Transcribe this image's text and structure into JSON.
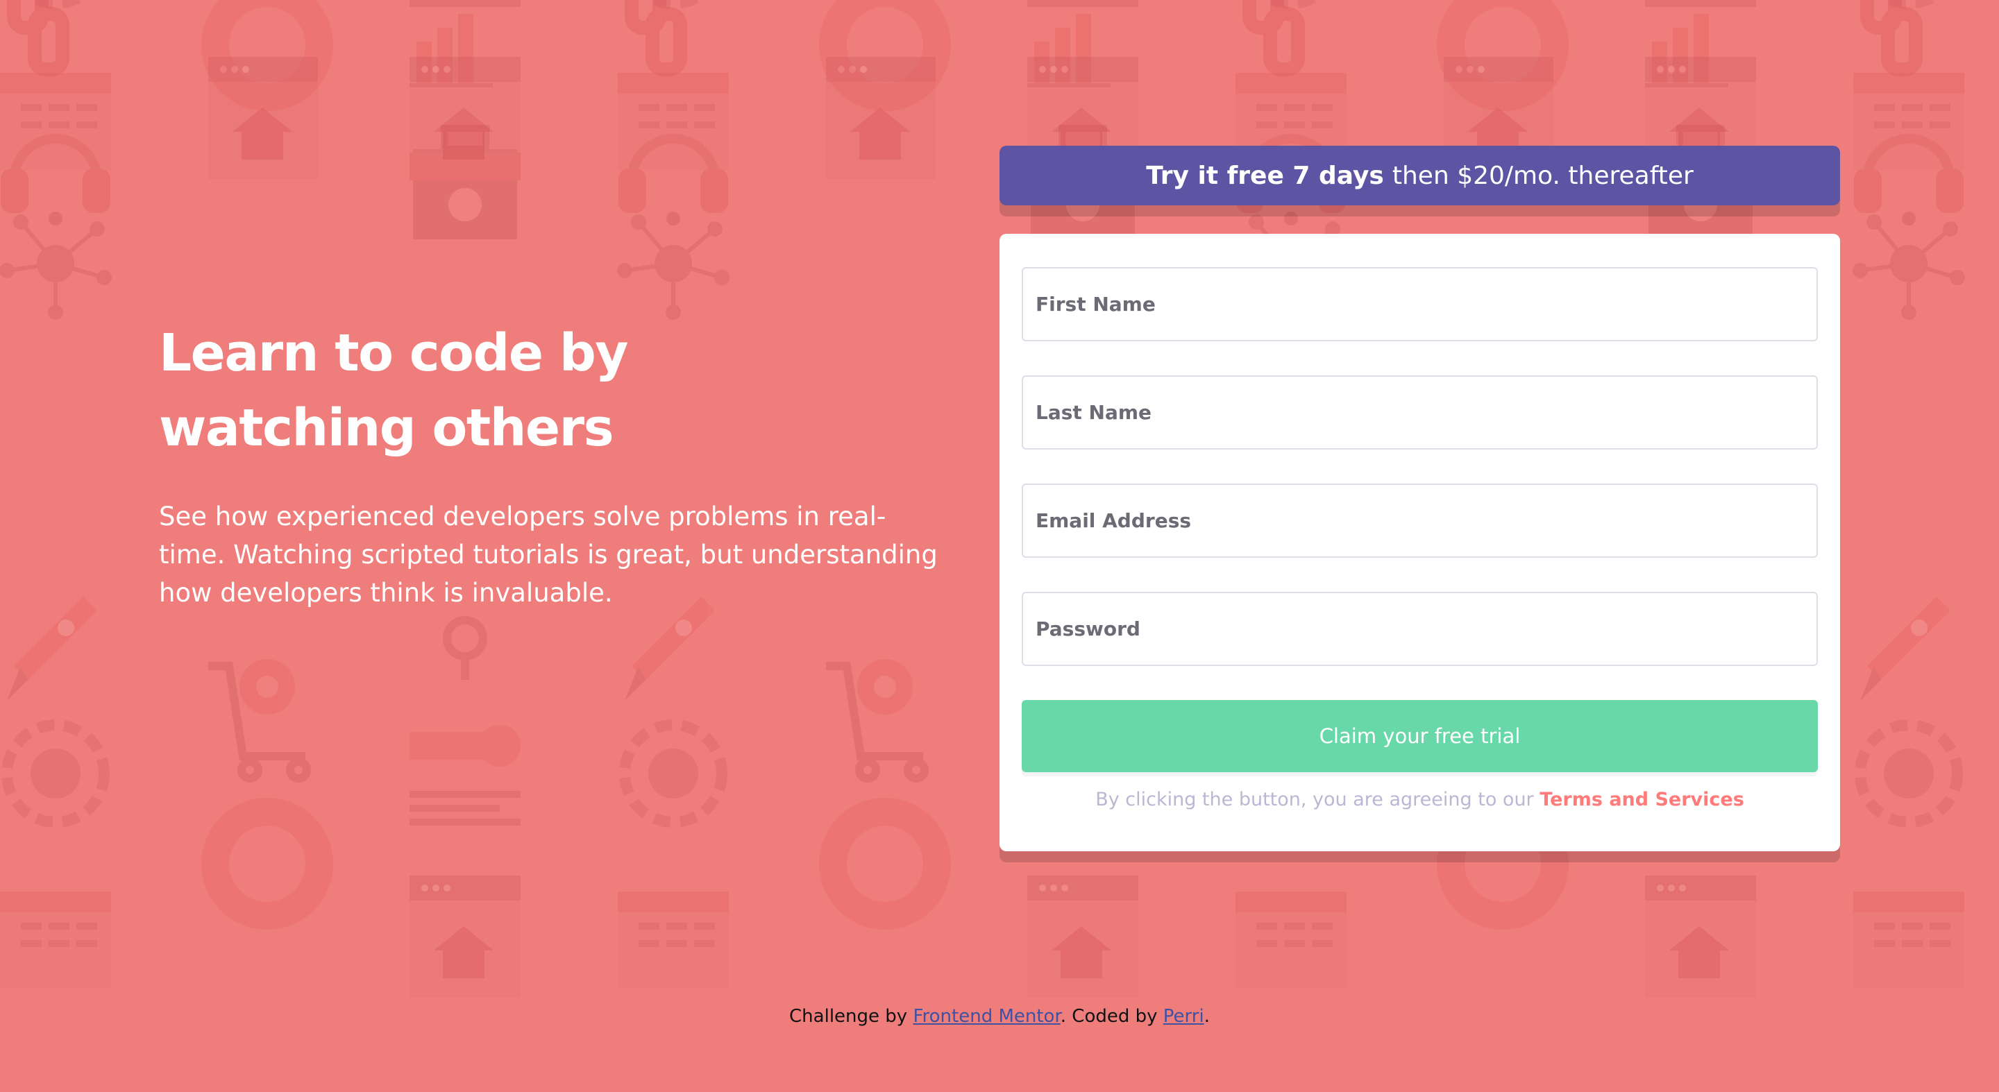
{
  "intro": {
    "title": "Learn to code by watching others",
    "description": "See how experienced developers solve problems in real-time. Watching scripted tutorials is great, but understanding how developers think is invaluable."
  },
  "promo": {
    "bold": "Try it free 7 days",
    "rest": "then $20/mo. thereafter"
  },
  "form": {
    "first_name_placeholder": "First Name",
    "last_name_placeholder": "Last Name",
    "email_placeholder": "Email Address",
    "password_placeholder": "Password",
    "submit_label": "Claim your free trial",
    "terms_prefix": "By clicking the button, you are agreeing to our",
    "terms_link": "Terms and Services"
  },
  "footer": {
    "prefix": "Challenge by",
    "mentor_link": "Frontend Mentor",
    "middle": ". Coded by",
    "author_link": "Perri",
    "suffix": "."
  },
  "colors": {
    "background": "#ef7d7b",
    "promo": "#5e54a4",
    "button": "#38cc8c",
    "terms_link": "#ff7a7a"
  },
  "background_icons": [
    "link-icon",
    "bar-chart-icon",
    "browser-window-icon",
    "home-icon",
    "headset-icon",
    "toolbox-icon",
    "network-icon",
    "rocket-icon",
    "cart-icon",
    "gear-icon",
    "key-icon",
    "globe-icon",
    "lifebuoy-icon",
    "calendar-icon",
    "magnifier-icon"
  ]
}
